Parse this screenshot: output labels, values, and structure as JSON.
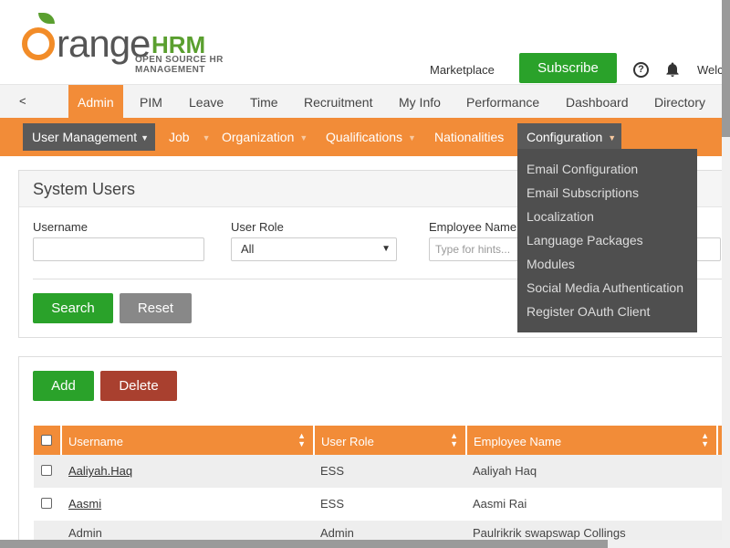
{
  "header": {
    "logo_text": "OrangeHRM",
    "logo_letters": "range",
    "logo_hrm": "HRM",
    "logo_tagline": "OPEN SOURCE HR MANAGEMENT",
    "marketplace": "Marketplace",
    "subscribe": "Subscribe",
    "help_symbol": "?",
    "welcome": "Welcome"
  },
  "main_menu": {
    "back": "<",
    "items": [
      "Admin",
      "PIM",
      "Leave",
      "Time",
      "Recruitment",
      "My Info",
      "Performance",
      "Dashboard",
      "Directory"
    ],
    "active": "Admin"
  },
  "sub_menu": {
    "items": [
      "User Management",
      "Job",
      "Organization",
      "Qualifications",
      "Nationalities",
      "Configuration"
    ],
    "caret": "▼"
  },
  "config_dropdown": {
    "items": [
      "Email Configuration",
      "Email Subscriptions",
      "Localization",
      "Language Packages",
      "Modules",
      "Social Media Authentication",
      "Register OAuth Client"
    ]
  },
  "search_panel": {
    "title": "System Users",
    "username_label": "Username",
    "username_value": "",
    "user_role_label": "User Role",
    "user_role_selected": "All",
    "employee_name_label": "Employee Name",
    "employee_name_placeholder": "Type for hints...",
    "search_button": "Search",
    "reset_button": "Reset"
  },
  "results": {
    "add_button": "Add",
    "delete_button": "Delete",
    "columns": [
      "Username",
      "User Role",
      "Employee Name"
    ],
    "rows": [
      {
        "username": "Aaliyah.Haq",
        "role": "ESS",
        "employee": "Aaliyah Haq"
      },
      {
        "username": "Aasmi",
        "role": "ESS",
        "employee": "Aasmi Rai"
      },
      {
        "username": "Admin",
        "role": "Admin",
        "employee": "Paulrikrik swapswap Collings"
      }
    ]
  },
  "colors": {
    "accent_orange": "#f28c38",
    "green": "#2aa22a",
    "delete_red": "#a9402f",
    "dropdown_bg": "#4f4f4f"
  }
}
